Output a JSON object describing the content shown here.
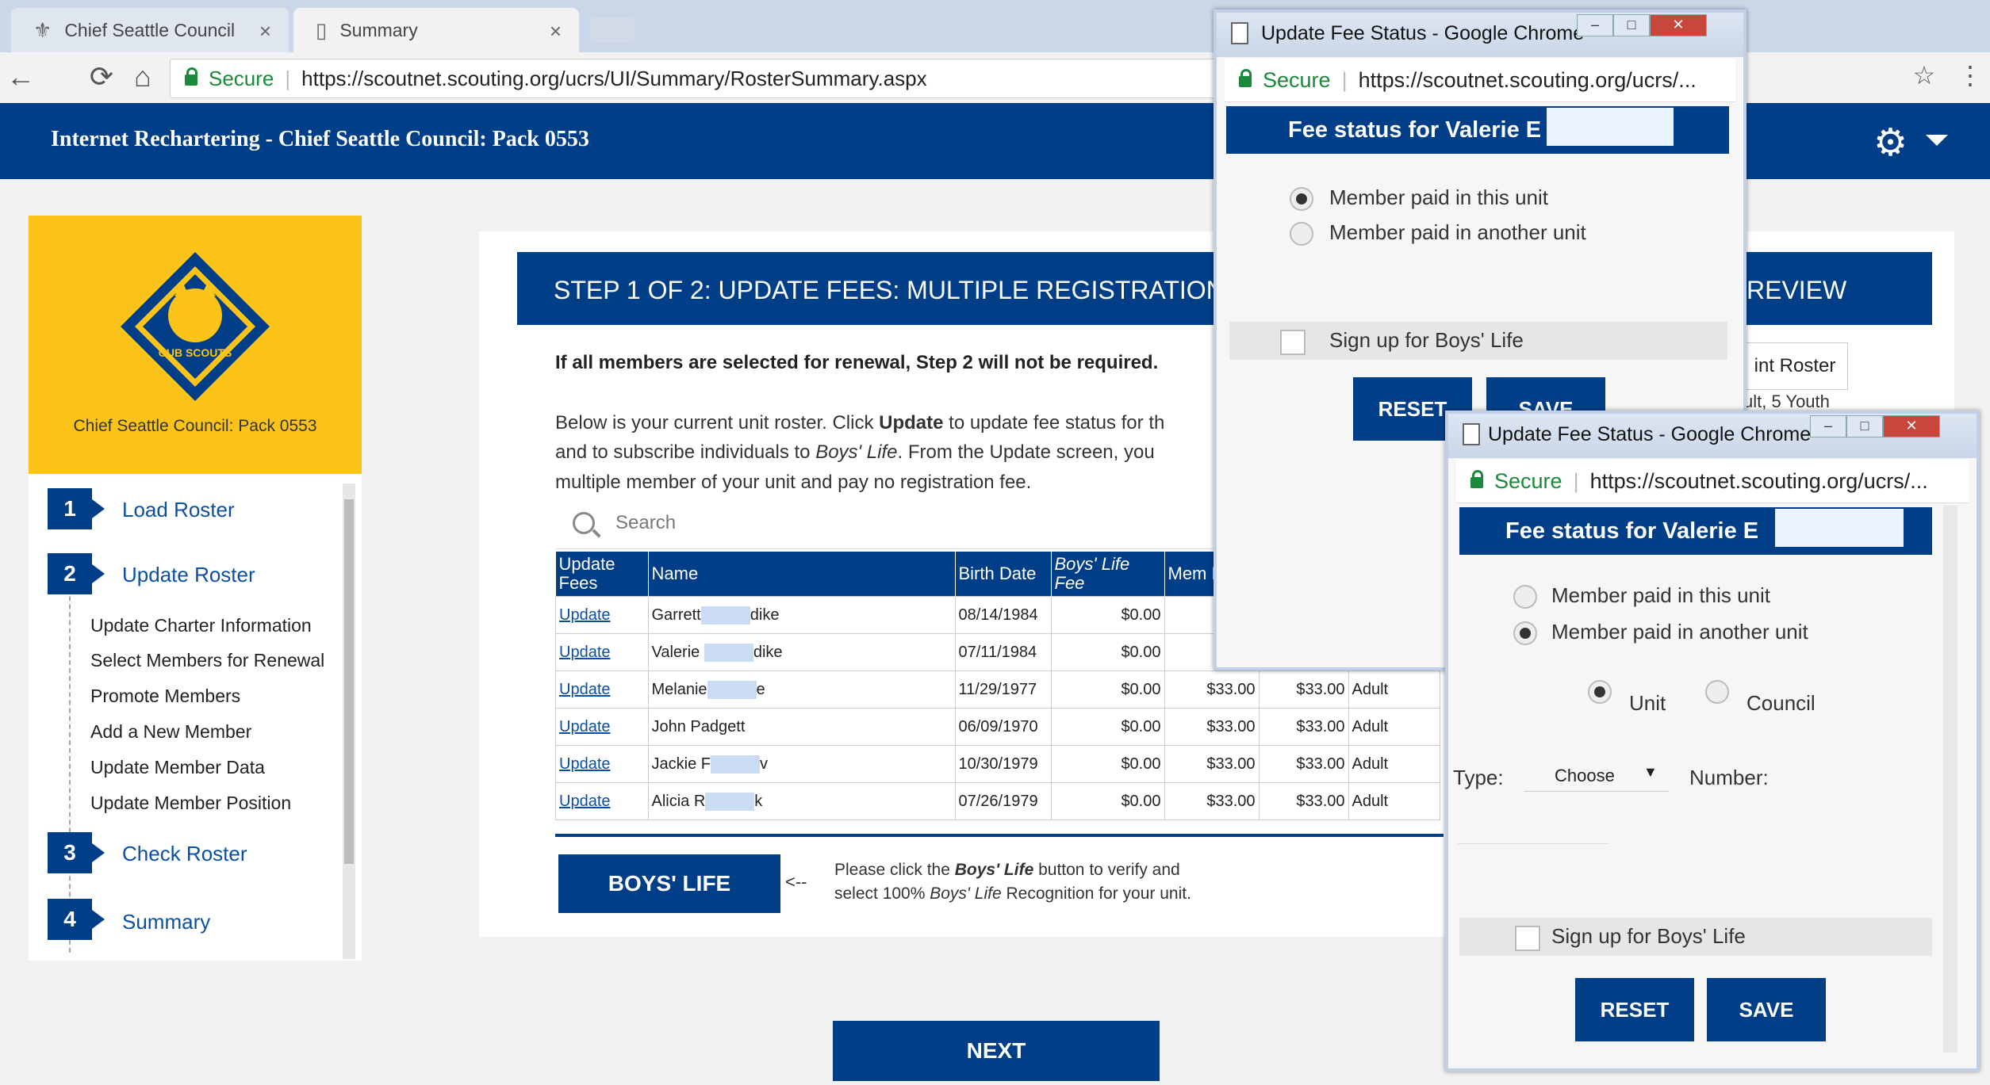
{
  "browser": {
    "tabs": [
      {
        "label": "Chief Seattle Council",
        "close": "×"
      },
      {
        "label": "Summary",
        "close": "×"
      }
    ],
    "secure_label": "Secure",
    "url": "https://scoutnet.scouting.org/ucrs/UI/Summary/RosterSummary.aspx",
    "back": "←",
    "reload": "⟳",
    "home": "⌂",
    "star": "☆",
    "menu": "⋮"
  },
  "header": {
    "title": "Internet Rechartering - Chief Seattle Council: Pack 0553",
    "gear": "⚙"
  },
  "sidebar": {
    "logo_text": "CUB SCOUTS",
    "council_label": "Chief Seattle Council: Pack 0553",
    "steps": [
      {
        "num": "1",
        "label": "Load Roster"
      },
      {
        "num": "2",
        "label": "Update Roster"
      },
      {
        "num": "3",
        "label": "Check Roster"
      },
      {
        "num": "4",
        "label": "Summary"
      }
    ],
    "substeps": [
      "Update Charter Information",
      "Select Members for Renewal",
      "Promote Members",
      "Add a New Member",
      "Update Member Data",
      "Update Member Position"
    ]
  },
  "main": {
    "step_title": "STEP 1 OF 2: UPDATE FEES: MULTIPLE REGISTRATION",
    "step_title_end": "REVIEW",
    "notice": "If all members are selected for renewal, Step 2 will not be required.",
    "para1a": "Below is your current unit roster. Click ",
    "para1b": "Update",
    "para1c": " to update fee status for th",
    "para2a": "and to subscribe individuals to ",
    "para2b": "Boys' Life",
    "para2c": ". From the Update screen, you",
    "para3": "multiple member of your unit and pay no registration fee.",
    "search_placeholder": "Search",
    "print_roster": "int Roster",
    "youth_text": "ult, 5 Youth",
    "table": {
      "headers": [
        "Update Fees",
        "Name",
        "Birth Date",
        "Boys' Life Fee",
        "Mem Fee"
      ],
      "rows": [
        {
          "update": "Update",
          "name_a": "Garrett",
          "name_b": "dike",
          "birth": "08/14/1984",
          "bl": "$0.00",
          "mem": "",
          "total": "",
          "type": ""
        },
        {
          "update": "Update",
          "name_a": "Valerie",
          "name_b": "dike",
          "birth": "07/11/1984",
          "bl": "$0.00",
          "mem": "",
          "total": "",
          "type": ""
        },
        {
          "update": "Update",
          "name_a": "Melanie",
          "name_b": "e",
          "birth": "11/29/1977",
          "bl": "$0.00",
          "mem": "$33.00",
          "total": "$33.00",
          "type": "Adult"
        },
        {
          "update": "Update",
          "name_a": "John Padgett",
          "name_b": "",
          "birth": "06/09/1970",
          "bl": "$0.00",
          "mem": "$33.00",
          "total": "$33.00",
          "type": "Adult"
        },
        {
          "update": "Update",
          "name_a": "Jackie F",
          "name_b": "v",
          "birth": "10/30/1979",
          "bl": "$0.00",
          "mem": "$33.00",
          "total": "$33.00",
          "type": "Adult"
        },
        {
          "update": "Update",
          "name_a": "Alicia R",
          "name_b": "k",
          "birth": "07/26/1979",
          "bl": "$0.00",
          "mem": "$33.00",
          "total": "$33.00",
          "type": "Adult"
        }
      ]
    },
    "boys_life_button": "BOYS' LIFE",
    "arrow": "<--",
    "bl_note1a": "Please click the ",
    "bl_note1b": "Boys' Life",
    "bl_note1c": " button to verify and",
    "bl_note2a": "select 100% ",
    "bl_note2b": "Boys' Life",
    "bl_note2c": " Recognition for your unit.",
    "next_button": "NEXT"
  },
  "popup1": {
    "window_title": "Update Fee Status - Google Chrome",
    "secure_label": "Secure",
    "url": "https://scoutnet.scouting.org/ucrs/...",
    "heading": "Fee status for Valerie E",
    "radio_this_unit": "Member paid in this unit",
    "radio_another_unit": "Member paid in another unit",
    "signup": "Sign up for Boys' Life",
    "reset": "RESET",
    "save": "SAVE"
  },
  "popup2": {
    "window_title": "Update Fee Status - Google Chrome",
    "secure_label": "Secure",
    "url": "https://scoutnet.scouting.org/ucrs/...",
    "heading": "Fee status for Valerie E",
    "radio_this_unit": "Member paid in this unit",
    "radio_another_unit": "Member paid in another unit",
    "unit": "Unit",
    "council": "Council",
    "type_label": "Type:",
    "type_value": "Choose",
    "number_label": "Number:",
    "signup": "Sign up for Boys' Life",
    "reset": "RESET",
    "save": "SAVE"
  },
  "colors": {
    "brand_blue": "#003f87",
    "logo_yellow": "#fcc419",
    "secure_green": "#1a8a3a",
    "link_blue": "#0b4fa3"
  }
}
